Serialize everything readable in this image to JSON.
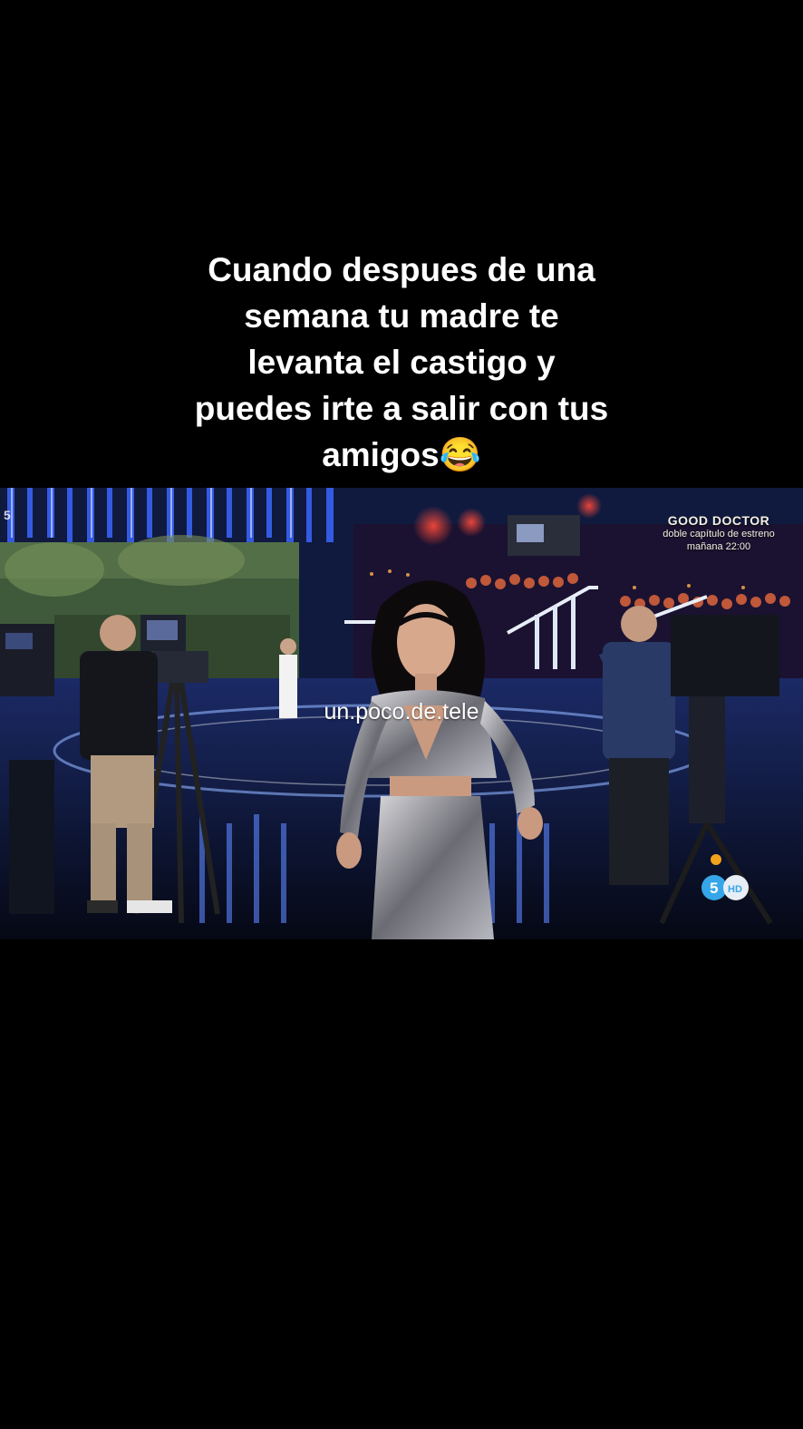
{
  "caption": {
    "lines": [
      "Cuando despues de una",
      "semana tu madre te",
      "levanta el castigo y",
      "puedes irte a salir con tus",
      "amigos😂"
    ]
  },
  "video": {
    "watermark": "un.poco.de.tele",
    "promo": {
      "title": "GOOD DOCTOR",
      "subtitle": "doble capítulo de estreno",
      "time": "mañana 22:00"
    },
    "channel_logo": {
      "number": "5",
      "badge": "HD"
    },
    "corner_logo": "5"
  },
  "colors": {
    "background": "#000000",
    "caption_text": "#ffffff",
    "stage_blue": "#2a4fd6",
    "channel_blue": "#36a6e8"
  }
}
